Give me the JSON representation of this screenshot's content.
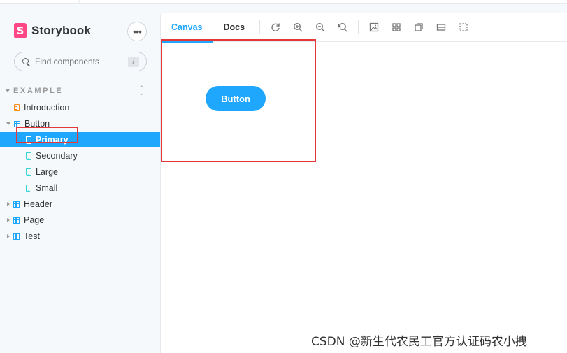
{
  "brand": {
    "logo_letter": "S",
    "name": "Storybook",
    "menu": "•••"
  },
  "search": {
    "placeholder": "Find components",
    "shortcut": "/"
  },
  "sidebar": {
    "section": "EXAMPLE",
    "items": [
      {
        "label": "Introduction",
        "icon": "doc-icon"
      },
      {
        "label": "Button",
        "icon": "component-icon"
      },
      {
        "label": "Primary",
        "icon": "bookmark-icon"
      },
      {
        "label": "Secondary",
        "icon": "bookmark-icon"
      },
      {
        "label": "Large",
        "icon": "bookmark-icon"
      },
      {
        "label": "Small",
        "icon": "bookmark-icon"
      },
      {
        "label": "Header",
        "icon": "component-icon"
      },
      {
        "label": "Page",
        "icon": "component-icon"
      },
      {
        "label": "Test",
        "icon": "component-icon"
      }
    ]
  },
  "toolbar": {
    "tabs": [
      {
        "label": "Canvas"
      },
      {
        "label": "Docs"
      }
    ]
  },
  "preview": {
    "button_label": "Button"
  },
  "watermark": "CSDN @新生代农民工官方认证码农小拽",
  "colors": {
    "accent": "#1ea7fd",
    "brand": "#ff4785",
    "highlight": "#e5383b"
  }
}
